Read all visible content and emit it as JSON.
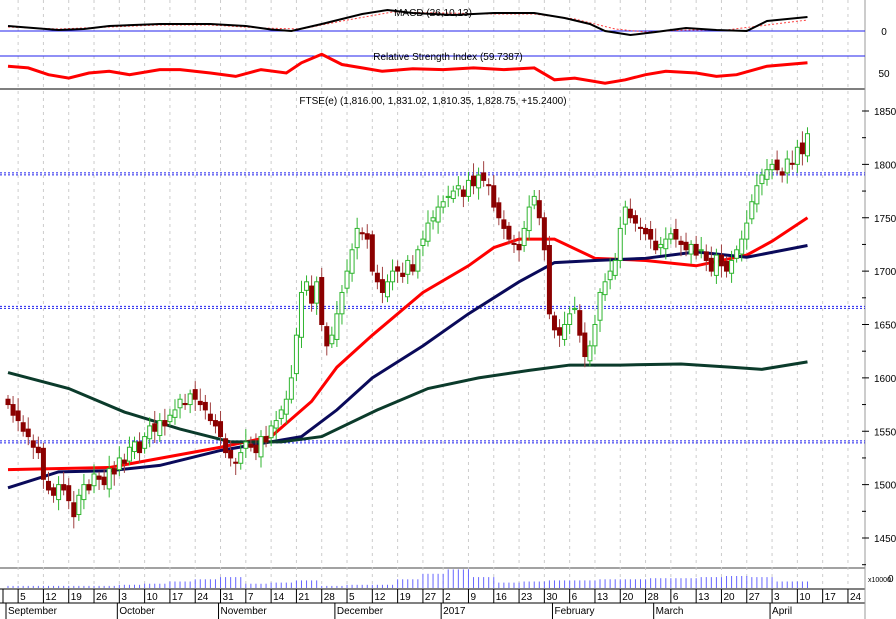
{
  "chart_data": {
    "type": "candlestick",
    "instrument_label": "FTSE(e) (1,816.00, 1,831.02, 1,810.35, 1,828.75, +15.2400)",
    "macd_label": "MACD (26,10,13)",
    "rsi_label": "Relative Strength Index (59.7387)",
    "macd_axis_labels": [
      "0"
    ],
    "rsi_axis_labels": [
      "50"
    ],
    "volume_axis_label": "x10000",
    "volume_axis_value": "0",
    "y_ticks": [
      1850,
      1800,
      1750,
      1700,
      1650,
      1600,
      1550,
      1500,
      1450
    ],
    "ylim": [
      1430,
      1860
    ],
    "horizontal_lines": [
      1792,
      1667,
      1541
    ],
    "closes": [
      1575,
      1565,
      1560,
      1550,
      1545,
      1535,
      1530,
      1505,
      1495,
      1490,
      1500,
      1495,
      1485,
      1470,
      1490,
      1500,
      1495,
      1510,
      1505,
      1500,
      1515,
      1510,
      1525,
      1520,
      1535,
      1540,
      1530,
      1545,
      1555,
      1550,
      1560,
      1555,
      1565,
      1570,
      1580,
      1575,
      1585,
      1580,
      1575,
      1570,
      1560,
      1555,
      1545,
      1530,
      1525,
      1520,
      1530,
      1540,
      1535,
      1530,
      1545,
      1540,
      1555,
      1560,
      1570,
      1580,
      1600,
      1640,
      1680,
      1690,
      1670,
      1690,
      1650,
      1630,
      1640,
      1660,
      1680,
      1700,
      1720,
      1740,
      1735,
      1730,
      1700,
      1690,
      1680,
      1690,
      1700,
      1700,
      1695,
      1710,
      1700,
      1720,
      1730,
      1745,
      1750,
      1760,
      1765,
      1770,
      1775,
      1780,
      1770,
      1785,
      1780,
      1790,
      1785,
      1780,
      1760,
      1750,
      1740,
      1730,
      1725,
      1720,
      1740,
      1760,
      1770,
      1750,
      1720,
      1660,
      1645,
      1640,
      1650,
      1660,
      1665,
      1640,
      1620,
      1630,
      1650,
      1680,
      1690,
      1700,
      1710,
      1740,
      1760,
      1750,
      1745,
      1740,
      1735,
      1730,
      1720,
      1725,
      1730,
      1735,
      1730,
      1725,
      1720,
      1725,
      1715,
      1720,
      1710,
      1700,
      1715,
      1705,
      1700,
      1710,
      1720,
      1730,
      1745,
      1765,
      1780,
      1790,
      1795,
      1800,
      1795,
      1790,
      1805,
      1800,
      1816,
      1810,
      1828.75
    ],
    "moving_averages": [
      {
        "name": "MA short",
        "color": "#ff0000",
        "points": [
          [
            0,
            1514
          ],
          [
            20,
            1516
          ],
          [
            42,
            1535
          ],
          [
            52,
            1545
          ],
          [
            60,
            1578
          ],
          [
            65,
            1610
          ],
          [
            72,
            1640
          ],
          [
            82,
            1680
          ],
          [
            91,
            1705
          ],
          [
            96,
            1722
          ],
          [
            101,
            1730
          ],
          [
            108,
            1730
          ],
          [
            116,
            1712
          ],
          [
            126,
            1710
          ],
          [
            136,
            1705
          ],
          [
            146,
            1715
          ],
          [
            151,
            1728
          ],
          [
            158,
            1750
          ]
        ]
      },
      {
        "name": "MA medium",
        "color": "#0a0a5a",
        "points": [
          [
            0,
            1497
          ],
          [
            10,
            1512
          ],
          [
            20,
            1513
          ],
          [
            30,
            1518
          ],
          [
            42,
            1532
          ],
          [
            58,
            1545
          ],
          [
            65,
            1570
          ],
          [
            72,
            1600
          ],
          [
            82,
            1630
          ],
          [
            91,
            1660
          ],
          [
            101,
            1690
          ],
          [
            108,
            1708
          ],
          [
            116,
            1710
          ],
          [
            126,
            1712
          ],
          [
            136,
            1718
          ],
          [
            146,
            1713
          ],
          [
            158,
            1724
          ]
        ]
      },
      {
        "name": "MA long",
        "color": "#0b3b2b",
        "points": [
          [
            0,
            1605
          ],
          [
            12,
            1590
          ],
          [
            23,
            1568
          ],
          [
            34,
            1552
          ],
          [
            44,
            1540
          ],
          [
            54,
            1540
          ],
          [
            62,
            1545
          ],
          [
            73,
            1570
          ],
          [
            83,
            1590
          ],
          [
            93,
            1600
          ],
          [
            103,
            1607
          ],
          [
            111,
            1612
          ],
          [
            121,
            1612
          ],
          [
            133,
            1613
          ],
          [
            143,
            1610
          ],
          [
            149,
            1608
          ],
          [
            158,
            1615
          ]
        ]
      }
    ],
    "macd": {
      "line": [
        [
          0,
          10
        ],
        [
          5,
          6
        ],
        [
          10,
          2
        ],
        [
          15,
          4
        ],
        [
          20,
          10
        ],
        [
          30,
          14
        ],
        [
          40,
          14
        ],
        [
          47,
          10
        ],
        [
          52,
          3
        ],
        [
          56,
          0
        ],
        [
          62,
          14
        ],
        [
          70,
          34
        ],
        [
          75,
          42
        ],
        [
          80,
          36
        ],
        [
          88,
          32
        ],
        [
          96,
          36
        ],
        [
          104,
          36
        ],
        [
          110,
          26
        ],
        [
          115,
          14
        ],
        [
          118,
          0
        ],
        [
          123,
          -8
        ],
        [
          128,
          -2
        ],
        [
          134,
          6
        ],
        [
          140,
          2
        ],
        [
          146,
          0
        ],
        [
          150,
          20
        ],
        [
          154,
          24
        ],
        [
          158,
          28
        ]
      ],
      "signal": [
        [
          0,
          8
        ],
        [
          10,
          4
        ],
        [
          20,
          8
        ],
        [
          30,
          12
        ],
        [
          40,
          12
        ],
        [
          50,
          6
        ],
        [
          58,
          4
        ],
        [
          66,
          20
        ],
        [
          76,
          38
        ],
        [
          86,
          36
        ],
        [
          96,
          34
        ],
        [
          104,
          34
        ],
        [
          112,
          24
        ],
        [
          120,
          4
        ],
        [
          126,
          -2
        ],
        [
          134,
          2
        ],
        [
          142,
          2
        ],
        [
          150,
          12
        ],
        [
          158,
          22
        ]
      ]
    },
    "rsi": [
      [
        0,
        58
      ],
      [
        4,
        56
      ],
      [
        8,
        48
      ],
      [
        12,
        44
      ],
      [
        16,
        50
      ],
      [
        20,
        52
      ],
      [
        24,
        48
      ],
      [
        30,
        54
      ],
      [
        34,
        54
      ],
      [
        40,
        50
      ],
      [
        45,
        46
      ],
      [
        50,
        54
      ],
      [
        55,
        50
      ],
      [
        58,
        62
      ],
      [
        62,
        72
      ],
      [
        66,
        60
      ],
      [
        70,
        56
      ],
      [
        74,
        52
      ],
      [
        80,
        55
      ],
      [
        86,
        54
      ],
      [
        92,
        56
      ],
      [
        98,
        54
      ],
      [
        104,
        56
      ],
      [
        108,
        42
      ],
      [
        112,
        44
      ],
      [
        118,
        38
      ],
      [
        122,
        42
      ],
      [
        126,
        48
      ],
      [
        130,
        52
      ],
      [
        136,
        50
      ],
      [
        140,
        46
      ],
      [
        144,
        48
      ],
      [
        150,
        58
      ],
      [
        158,
        62
      ]
    ],
    "volume_weekly": [
      1,
      1,
      1,
      1,
      1,
      2,
      3,
      5,
      7,
      9,
      3,
      4,
      6,
      1,
      2,
      2,
      7,
      12,
      16,
      9,
      4,
      5,
      6,
      6,
      7,
      7,
      8,
      8,
      9,
      10,
      9,
      5,
      5
    ],
    "x_day_ticks": [
      {
        "label": "5",
        "day": 2
      },
      {
        "label": "12",
        "day": 7
      },
      {
        "label": "19",
        "day": 12
      },
      {
        "label": "26",
        "day": 17
      },
      {
        "label": "3",
        "day": 22
      },
      {
        "label": "10",
        "day": 27
      },
      {
        "label": "17",
        "day": 32
      },
      {
        "label": "24",
        "day": 37
      },
      {
        "label": "31",
        "day": 42
      },
      {
        "label": "7",
        "day": 47
      },
      {
        "label": "14",
        "day": 52
      },
      {
        "label": "21",
        "day": 57
      },
      {
        "label": "28",
        "day": 62
      },
      {
        "label": "5",
        "day": 67
      },
      {
        "label": "12",
        "day": 72
      },
      {
        "label": "19",
        "day": 77
      },
      {
        "label": "27",
        "day": 82
      },
      {
        "label": "2",
        "day": 86
      },
      {
        "label": "9",
        "day": 91
      },
      {
        "label": "16",
        "day": 96
      },
      {
        "label": "23",
        "day": 101
      },
      {
        "label": "30",
        "day": 106
      },
      {
        "label": "6",
        "day": 111
      },
      {
        "label": "13",
        "day": 116
      },
      {
        "label": "20",
        "day": 121
      },
      {
        "label": "28",
        "day": 126
      },
      {
        "label": "6",
        "day": 131
      },
      {
        "label": "13",
        "day": 136
      },
      {
        "label": "20",
        "day": 141
      },
      {
        "label": "27",
        "day": 146
      },
      {
        "label": "3",
        "day": 151
      },
      {
        "label": "10",
        "day": 156
      },
      {
        "label": "17",
        "day": 161
      },
      {
        "label": "24",
        "day": 166
      }
    ],
    "x_month_labels": [
      {
        "label": "September",
        "day": 0
      },
      {
        "label": "October",
        "day": 22
      },
      {
        "label": "November",
        "day": 42
      },
      {
        "label": "December",
        "day": 65
      },
      {
        "label": "2017",
        "day": 86
      },
      {
        "label": "February",
        "day": 108
      },
      {
        "label": "March",
        "day": 128
      },
      {
        "label": "April",
        "day": 151
      }
    ]
  }
}
